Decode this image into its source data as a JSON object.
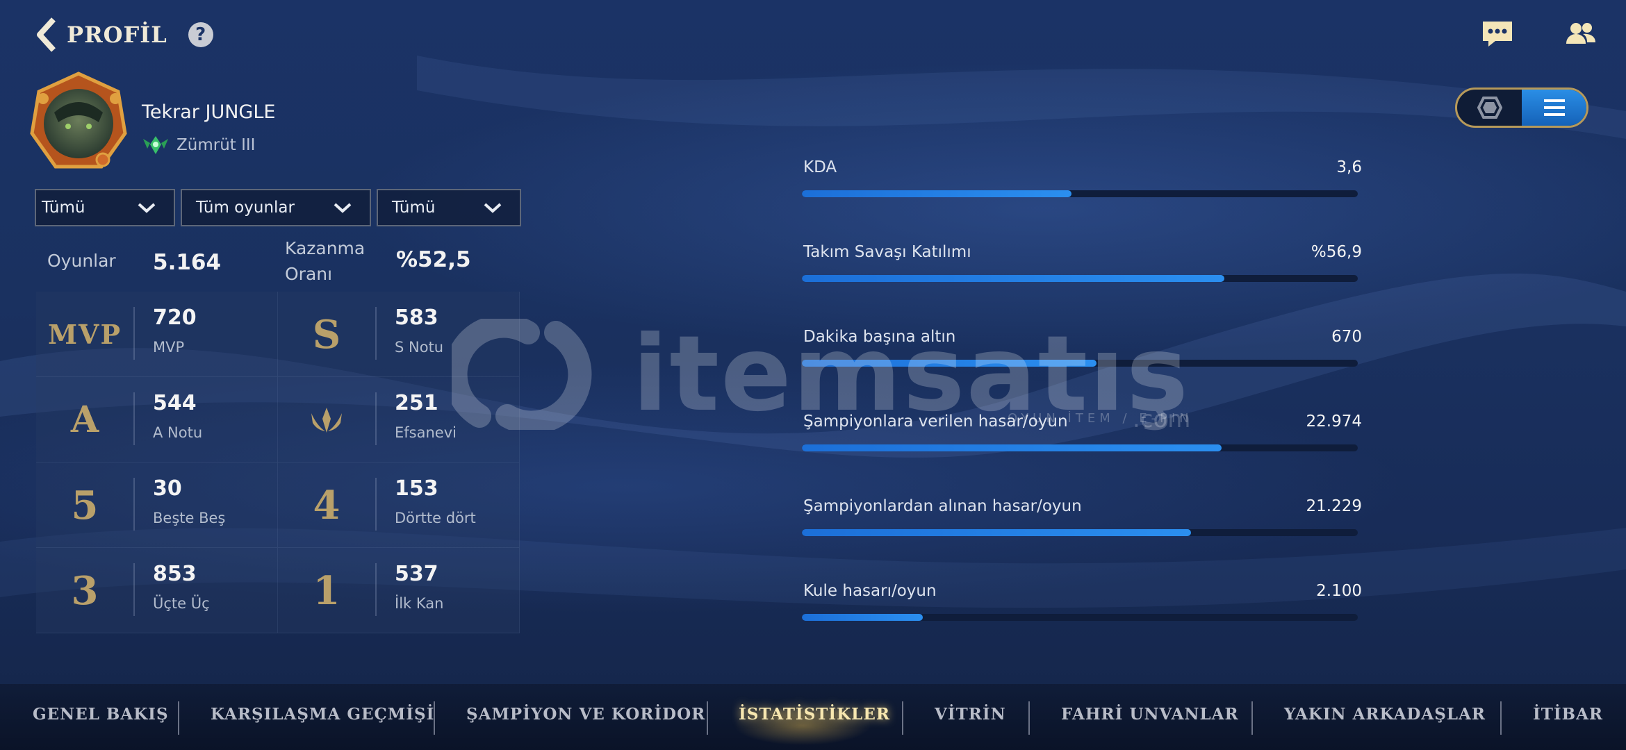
{
  "header": {
    "title": "PROFİL",
    "help_label": "?"
  },
  "profile": {
    "name": "Tekrar JUNGLE",
    "rank": "Zümrüt III"
  },
  "filters": [
    {
      "selected": "Tümü"
    },
    {
      "selected": "Tüm oyunlar"
    },
    {
      "selected": "Tümü"
    }
  ],
  "summary": {
    "games_label": "Oyunlar",
    "games_value": "5.164",
    "winrate_label_1": "Kazanma",
    "winrate_label_2": "Oranı",
    "winrate_value": "%52,5"
  },
  "stats": [
    {
      "badge": "MVP",
      "value": "720",
      "label": "MVP"
    },
    {
      "badge": "S",
      "value": "583",
      "label": "S Notu"
    },
    {
      "badge": "A",
      "value": "544",
      "label": "A Notu"
    },
    {
      "badge": "legendary-icon",
      "value": "251",
      "label": "Efsanevi"
    },
    {
      "badge": "5",
      "value": "30",
      "label": "Beşte Beş"
    },
    {
      "badge": "4",
      "value": "153",
      "label": "Dörtte dört"
    },
    {
      "badge": "3",
      "value": "853",
      "label": "Üçte Üç"
    },
    {
      "badge": "1",
      "value": "537",
      "label": "İlk Kan"
    }
  ],
  "bars": [
    {
      "label": "KDA",
      "value": "3,6",
      "fill": 0.485
    },
    {
      "label": "Takım Savaşı Katılımı",
      "value": "%56,9",
      "fill": 0.76
    },
    {
      "label": "Dakika başına altın",
      "value": "670",
      "fill": 0.53
    },
    {
      "label": "Şampiyonlara verilen hasar/oyun",
      "value": "22.974",
      "fill": 0.755
    },
    {
      "label": "Şampiyonlardan alınan hasar/oyun",
      "value": "21.229",
      "fill": 0.7
    },
    {
      "label": "Kule hasarı/oyun",
      "value": "2.100",
      "fill": 0.218
    }
  ],
  "watermark": {
    "brand": "itemsatış",
    "sub": "OYUN İTEM / E-PIN",
    "domain": ".com"
  },
  "nav": [
    {
      "label": "GENEL BAKIŞ",
      "active": false
    },
    {
      "label": "KARŞILAŞMA GEÇMİŞİ",
      "active": false
    },
    {
      "label": "ŞAMPİYON VE KORİDOR",
      "active": false
    },
    {
      "label": "İSTATİSTİKLER",
      "active": true
    },
    {
      "label": "VİTRİN",
      "active": false
    },
    {
      "label": "FAHRİ UNVANLAR",
      "active": false
    },
    {
      "label": "YAKIN ARKADAŞLAR",
      "active": false
    },
    {
      "label": "İTİBAR",
      "active": false
    }
  ],
  "colors": {
    "accent": "#1f7de0",
    "gold": "#b9a06a",
    "bg": "#1a3160"
  }
}
